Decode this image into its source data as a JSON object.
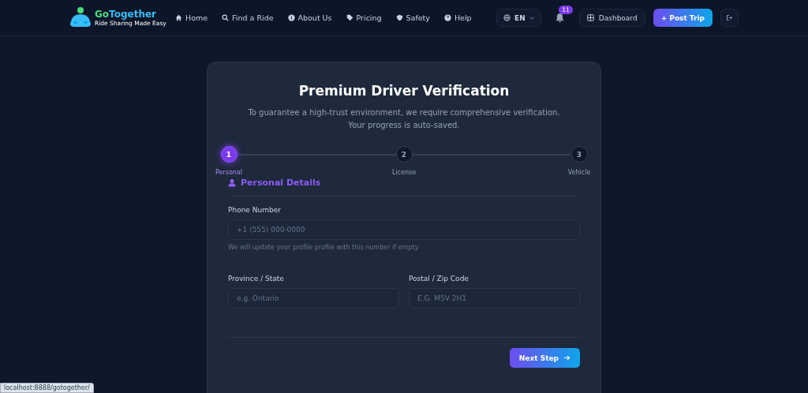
{
  "brand": {
    "name_part_1": "Go",
    "name_part_2": "Together",
    "tagline": "Ride Sharing Made Easy"
  },
  "nav": [
    {
      "label": "Home"
    },
    {
      "label": "Find a Ride"
    },
    {
      "label": "About Us"
    },
    {
      "label": "Pricing"
    },
    {
      "label": "Safety"
    },
    {
      "label": "Help"
    }
  ],
  "language": "EN",
  "notifications": "11",
  "dashboard": "Dashboard",
  "post_trip": "+ Post Trip",
  "card": {
    "title": "Premium Driver Verification",
    "subtitle": "To guarantee a high-trust environment, we require comprehensive verification. Your progress is auto-saved.",
    "steps": [
      {
        "number": "1",
        "label": "Personal",
        "selected": true
      },
      {
        "number": "2",
        "label": "License",
        "selected": false
      },
      {
        "number": "3",
        "label": "Vehicle",
        "selected": false
      }
    ],
    "section": "Personal Details",
    "phone": {
      "label": "Phone Number",
      "placeholder": "+1 (555) 000-0000",
      "hint": "We will update your profile profile with this number if empty."
    },
    "province": {
      "label": "Province / State",
      "placeholder": "e.g. Ontario"
    },
    "postal": {
      "label": "Postal / Zip Code",
      "placeholder": "E.G. M5V 2H1"
    },
    "next": "Next Step"
  },
  "status_url": "localhost:8888/gotogether/"
}
